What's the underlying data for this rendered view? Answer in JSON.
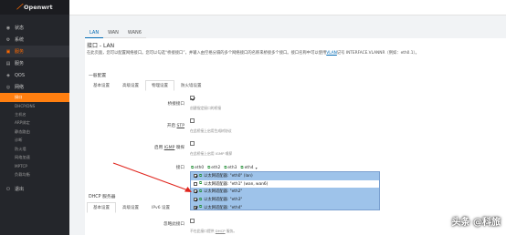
{
  "brand": {
    "name": "Openwrt"
  },
  "sidebar": {
    "items": [
      {
        "icon": "status-icon",
        "label": "状态"
      },
      {
        "icon": "system-icon",
        "label": "系统"
      },
      {
        "icon": "services-icon",
        "label": "服务"
      },
      {
        "icon": "nas-icon",
        "label": "服务"
      },
      {
        "icon": "qos-icon",
        "label": "QOS"
      },
      {
        "icon": "network-icon",
        "label": "网络"
      }
    ],
    "network_subitems": [
      {
        "label": "接口"
      },
      {
        "label": "DHCP/DNS"
      },
      {
        "label": "主机名"
      },
      {
        "label": "ARP绑定"
      },
      {
        "label": "静态路由"
      },
      {
        "label": "诊断"
      },
      {
        "label": "防火墙"
      },
      {
        "label": "网络加速"
      },
      {
        "label": "MPTCP"
      },
      {
        "label": "负载均衡"
      }
    ],
    "logout": "退出"
  },
  "tabs": [
    "LAN",
    "WAN",
    "WAN6"
  ],
  "page": {
    "title": "接口 - LAN",
    "description_part1": "在此页面，您可以配置网络接口。您可以勾选“桥接接口”，并输入由空格分隔的多个网络接口的名称来桥接多个接口。接口名称中可以使用",
    "description_link": "VLAN",
    "description_part2": "记号 INTERFACE.VLANNR（例如：eth0.1）。"
  },
  "section1": {
    "title": "一般配置",
    "subtabs": [
      "基本设置",
      "高级设置",
      "物理设置",
      "防火墙设置"
    ],
    "fields": [
      {
        "label": "桥接接口",
        "help": "创建指定接口的桥接"
      },
      {
        "label_prefix": "开启 ",
        "label_link": "STP",
        "help": "在此桥接上启用生成树协议"
      },
      {
        "label_prefix": "启用 ",
        "label_link": "IGMP",
        "label_suffix": " 嗅探",
        "help": "在此桥接上启用 IGMP 嗅探"
      },
      {
        "label": "接口"
      }
    ]
  },
  "interface_chips": [
    "eth0",
    "eth2",
    "eth3",
    "eth4"
  ],
  "dropdown": {
    "options": [
      {
        "text": "以太网适配器: \"eth0\" (lan)",
        "checked": true,
        "selected": true
      },
      {
        "text": "以太网适配器: \"eth1\" (wan, wan6)",
        "checked": false,
        "selected": false
      },
      {
        "text": "以太网适配器: \"eth2\"",
        "checked": true,
        "selected": true
      },
      {
        "text": "以太网适配器: \"eth3\"",
        "checked": true,
        "selected": true
      },
      {
        "text": "以太网适配器: \"eth4\"",
        "checked": true,
        "selected": true
      }
    ]
  },
  "section2": {
    "title": "DHCP 服务器",
    "subtabs": [
      "基本设置",
      "高级设置",
      "IPv6 设置"
    ],
    "fields": [
      {
        "label": "忽略此接口",
        "help_prefix": "不在此接口提供 ",
        "help_link": "DHCP",
        "help_suffix": " 服务。"
      }
    ]
  },
  "watermark": "头条 @科旅"
}
